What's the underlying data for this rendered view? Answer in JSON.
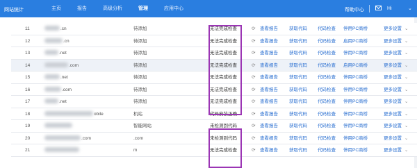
{
  "app": {
    "logo_text": "网站统计"
  },
  "nav": {
    "items": [
      {
        "label": "主页",
        "active": false
      },
      {
        "label": "报告",
        "active": false
      },
      {
        "label": "高级分析",
        "active": false
      },
      {
        "label": "管理",
        "active": true
      },
      {
        "label": "应用中心",
        "active": false
      }
    ],
    "help_label": "帮助中心",
    "user_greeting": "Hi"
  },
  "actions": {
    "view_report": "查看报告",
    "get_code": "获取代码",
    "code_check": "代码检查",
    "pc_enable": "启用PC商桥",
    "pc_disable": "停用PC商桥",
    "more_settings": "更多设置"
  },
  "rows": [
    {
      "num": "11",
      "site": ".cn",
      "type": "待添加",
      "status": "无法完成检查",
      "pc": "停用PC商桥"
    },
    {
      "num": "12",
      "site": ".cn",
      "type": "待添加",
      "status": "无法完成检查",
      "pc": "启用PC商桥"
    },
    {
      "num": "13",
      "site": ".net",
      "type": "待添加",
      "status": "无法完成检查",
      "pc": "停用PC商桥"
    },
    {
      "num": "14",
      "site": ".com",
      "type": "待添加",
      "status": "无法完成检查",
      "pc": "启用PC商桥"
    },
    {
      "num": "15",
      "site": ".net",
      "type": "待添加",
      "status": "无法完成检查",
      "pc": "停用PC商桥"
    },
    {
      "num": "16",
      "site": ".com",
      "type": "待添加",
      "status": "无法完成检查",
      "pc": "停用PC商桥"
    },
    {
      "num": "17",
      "site": ".net",
      "type": "待添加",
      "status": "无法完成检查",
      "pc": "停用PC商桥"
    },
    {
      "num": "18",
      "site": "obile",
      "type": "机站",
      "status": "代码安装正确",
      "pc": "停用PC商桥"
    },
    {
      "num": "19",
      "site": "",
      "type": "智能网站",
      "status": "未检测到代码",
      "pc": "停用PC商桥"
    },
    {
      "num": "20",
      "site": ".com",
      "type": ".com",
      "status": "未检测到代码",
      "pc": "停用PC商桥"
    },
    {
      "num": "21",
      "site": "",
      "type": "m",
      "status": "无法完成检查",
      "pc": "停用PC商桥"
    }
  ]
}
